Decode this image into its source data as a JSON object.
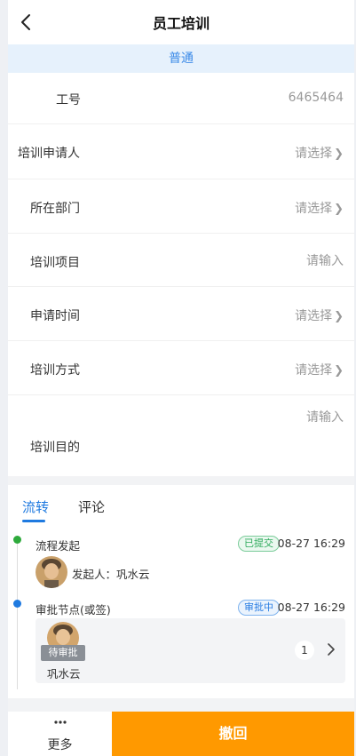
{
  "header": {
    "title": "员工培训"
  },
  "banner": {
    "text": "普通"
  },
  "form": {
    "employee_id": {
      "label": "工号",
      "value": "6465464"
    },
    "applicant": {
      "label": "培训申请人",
      "placeholder": "请选择"
    },
    "department": {
      "label": "所在部门",
      "placeholder": "请选择"
    },
    "project": {
      "label": "培训项目",
      "placeholder": "请输入"
    },
    "apply_time": {
      "label": "申请时间",
      "placeholder": "请选择"
    },
    "method": {
      "label": "培训方式",
      "placeholder": "请选择"
    },
    "purpose": {
      "label": "培训目的",
      "placeholder": "请输入"
    }
  },
  "tabs": [
    {
      "label": "流转",
      "active": true
    },
    {
      "label": "评论",
      "active": false
    }
  ],
  "timeline": [
    {
      "title": "流程发起",
      "status": "已提交",
      "time": "08-27 16:29",
      "initiator_label": "发起人：巩水云",
      "dot_color": "#2eaa3c"
    },
    {
      "title": "审批节点(或签)",
      "status": "审批中",
      "time": "08-27 16:29",
      "pending_label": "待审批",
      "approver": "巩水云",
      "count": "1",
      "dot_color": "#1f7ae0"
    }
  ],
  "footer": {
    "more_label": "更多",
    "revoke_label": "撤回"
  },
  "colors": {
    "accent": "#1f7ae0",
    "revoke": "#ff9900",
    "banner_bg": "#e6f1fc"
  },
  "icons": [
    "back-arrow-icon",
    "chevron-right-icon",
    "more-dots-icon",
    "avatar-image"
  ]
}
